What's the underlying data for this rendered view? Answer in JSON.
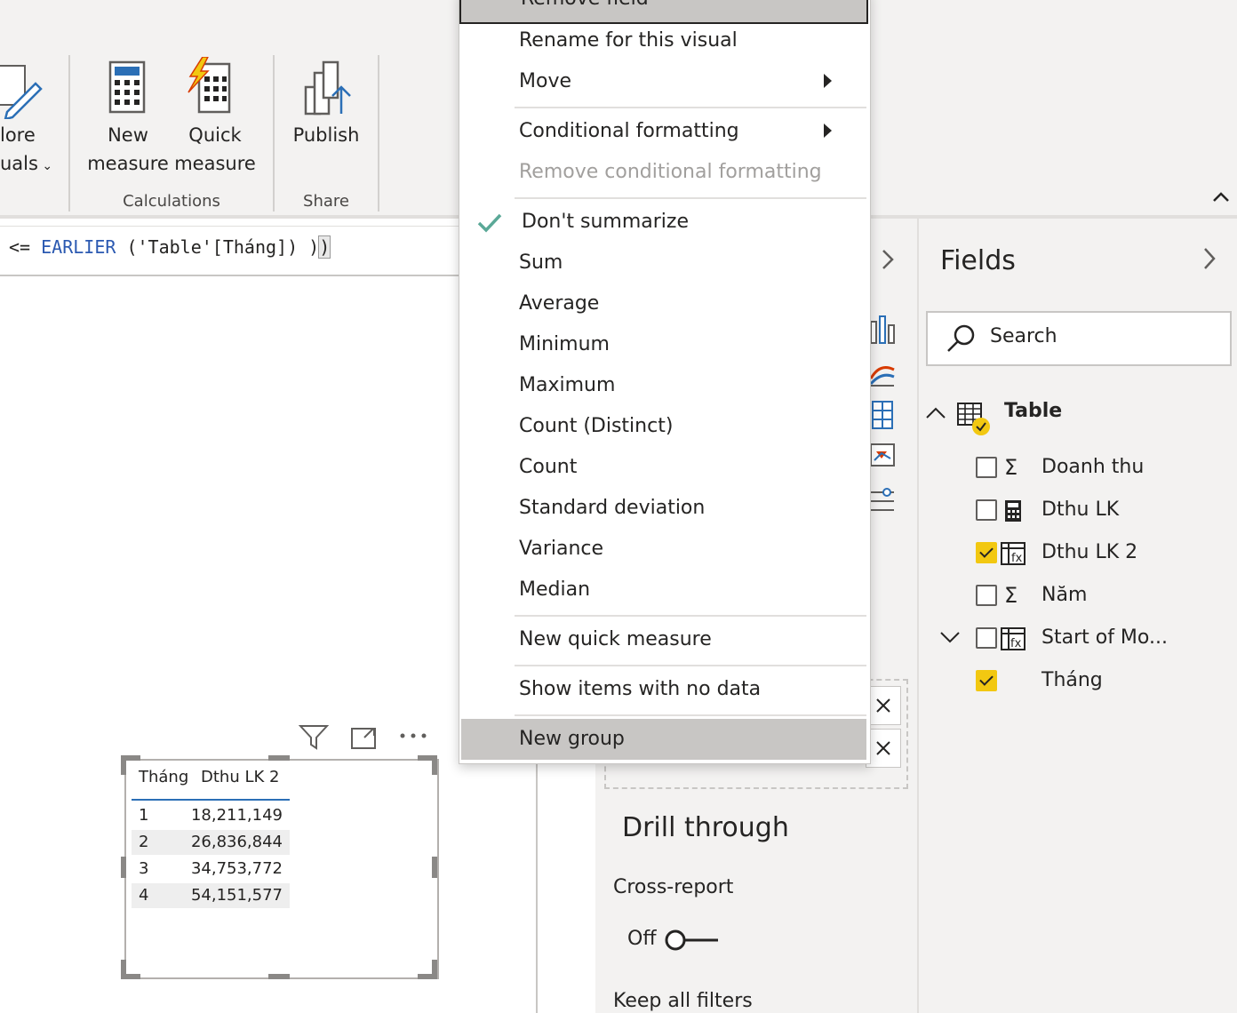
{
  "ribbon": {
    "more_visuals": {
      "line1": "lore",
      "line2": "uals"
    },
    "new_measure": {
      "line1": "New",
      "line2": "measure"
    },
    "quick_measure": {
      "line1": "Quick",
      "line2": "measure"
    },
    "publish": "Publish",
    "group_calculations": "Calculations",
    "group_share": "Share"
  },
  "formula": {
    "op": "<= ",
    "keyword": "EARLIER",
    "args": " ('Table'[Tháng]) )",
    "close": ")"
  },
  "context_menu": {
    "remove_field": "Remove field",
    "rename": "Rename for this visual",
    "move": "Move",
    "conditional_formatting": "Conditional formatting",
    "remove_conditional": "Remove conditional formatting",
    "dont_summarize": "Don't summarize",
    "sum": "Sum",
    "average": "Average",
    "minimum": "Minimum",
    "maximum": "Maximum",
    "count_distinct": "Count (Distinct)",
    "count": "Count",
    "std_dev": "Standard deviation",
    "variance": "Variance",
    "median": "Median",
    "new_quick_measure": "New quick measure",
    "show_no_data": "Show items with no data",
    "new_group": "New group"
  },
  "fields_pane": {
    "title": "Fields",
    "search_placeholder": "Search",
    "table_name": "Table",
    "fields": [
      {
        "name": "Doanh thu",
        "icon": "sigma-icon",
        "checked": false
      },
      {
        "name": "Dthu LK",
        "icon": "calculator-icon",
        "checked": false
      },
      {
        "name": "Dthu LK 2",
        "icon": "calculated-column-icon",
        "checked": true
      },
      {
        "name": "Năm",
        "icon": "sigma-icon",
        "checked": false
      },
      {
        "name": "Start of Mo...",
        "icon": "hierarchy-icon",
        "checked": false
      },
      {
        "name": "Tháng",
        "icon": "",
        "checked": true
      }
    ]
  },
  "filter_pane": {
    "drill_through": "Drill through",
    "cross_report": "Cross-report",
    "toggle_state": "Off",
    "keep_all_filters": "Keep all filters"
  },
  "table_visual": {
    "headers": [
      "Tháng",
      "Dthu LK 2"
    ],
    "rows": [
      [
        "1",
        "18,211,149"
      ],
      [
        "2",
        "26,836,844"
      ],
      [
        "3",
        "34,753,772"
      ],
      [
        "4",
        "54,151,577"
      ]
    ]
  },
  "colors": {
    "accent_yellow": "#f2c811",
    "check_green": "#5aa897",
    "menu_highlight": "#c8c6c4"
  }
}
